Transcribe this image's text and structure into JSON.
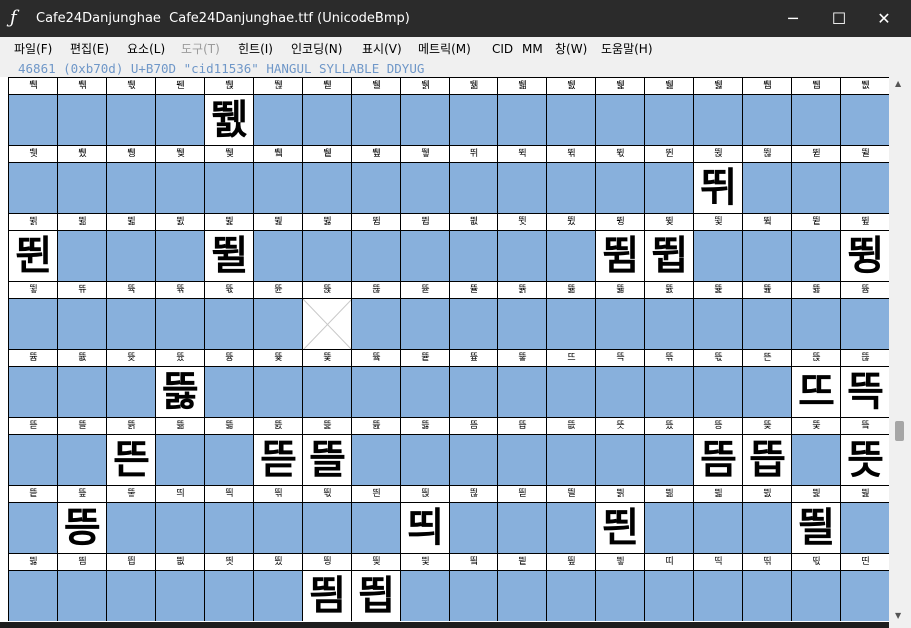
{
  "window": {
    "title": "Cafe24Danjunghae  Cafe24Danjunghae.ttf (UnicodeBmp)",
    "app_icon": "font-icon",
    "min_glyph": "─",
    "max_glyph": "☐",
    "close_glyph": "✕"
  },
  "menu": [
    {
      "label": "파일(F)",
      "enabled": true
    },
    {
      "label": "편집(E)",
      "enabled": true
    },
    {
      "label": "요소(L)",
      "enabled": true
    },
    {
      "label": "도구(T)",
      "enabled": false
    },
    {
      "label": "힌트(I)",
      "enabled": true
    },
    {
      "label": "인코딩(N)",
      "enabled": true
    },
    {
      "label": "표시(V)",
      "enabled": true
    },
    {
      "label": "메트릭(M)",
      "enabled": true
    },
    {
      "label": "CID",
      "enabled": true
    },
    {
      "label": "MM",
      "enabled": true
    },
    {
      "label": "창(W)",
      "enabled": true
    },
    {
      "label": "도움말(H)",
      "enabled": true
    }
  ],
  "glyph_info": "46861 (0xb70d) U+B70D \"cid11536\" HANGUL SYLLABLE DDYUG",
  "grid": {
    "columns": 18,
    "rows": [
      {
        "labels": [
          "뛕",
          "뛖",
          "뛗",
          "뛘",
          "뛙",
          "뛚",
          "뛛",
          "뛜",
          "뛝",
          "뛞",
          "뛟",
          "뛠",
          "뛡",
          "뛢",
          "뛣",
          "뛤",
          "뛥",
          "뛦"
        ],
        "glyphs": [
          "",
          "",
          "",
          "",
          "뛠",
          "",
          "",
          "",
          "",
          "",
          "",
          "",
          "",
          "",
          "",
          "",
          "",
          ""
        ]
      },
      {
        "labels": [
          "뛧",
          "뛨",
          "뛩",
          "뛪",
          "뛫",
          "뛬",
          "뛭",
          "뛮",
          "뛯",
          "뛰",
          "뛱",
          "뛲",
          "뛳",
          "뛴",
          "뛵",
          "뛶",
          "뛷",
          "뛸"
        ],
        "glyphs": [
          "",
          "",
          "",
          "",
          "",
          "",
          "",
          "",
          "",
          "",
          "",
          "",
          "",
          "",
          "뛰",
          "",
          "",
          ""
        ]
      },
      {
        "labels": [
          "뛹",
          "뛺",
          "뛻",
          "뛼",
          "뛽",
          "뛾",
          "뛿",
          "뜀",
          "뜁",
          "뜂",
          "뜃",
          "뜄",
          "뜅",
          "뜆",
          "뜇",
          "뜈",
          "뜉",
          "뜊"
        ],
        "glyphs": [
          "뛴",
          "",
          "",
          "",
          "뛸",
          "",
          "",
          "",
          "",
          "",
          "",
          "",
          "뜀",
          "뜁",
          "",
          "",
          "",
          "뜅"
        ]
      },
      {
        "labels": [
          "뜋",
          "뜌",
          "뜍",
          "뜎",
          "뜏",
          "뜐",
          "뜑",
          "뜒",
          "뜓",
          "뜔",
          "뜕",
          "뜖",
          "뜗",
          "뜘",
          "뜙",
          "뜚",
          "뜛",
          "뜜"
        ],
        "glyphs": [
          "",
          "",
          "",
          "",
          "",
          "",
          "✗",
          "",
          "",
          "",
          "",
          "",
          "",
          "",
          "",
          "",
          "",
          ""
        ]
      },
      {
        "labels": [
          "뜝",
          "뜞",
          "뜟",
          "뜠",
          "뜡",
          "뜢",
          "뜣",
          "뜤",
          "뜥",
          "뜦",
          "뜧",
          "뜨",
          "뜩",
          "뜪",
          "뜫",
          "뜬",
          "뜭",
          "뜮"
        ],
        "glyphs": [
          "",
          "",
          "",
          "뜷",
          "",
          "",
          "",
          "",
          "",
          "",
          "",
          "",
          "",
          "",
          "",
          "",
          "뜨",
          "뜩"
        ]
      },
      {
        "labels": [
          "뜯",
          "뜰",
          "뜱",
          "뜲",
          "뜳",
          "뜴",
          "뜵",
          "뜶",
          "뜷",
          "뜸",
          "뜹",
          "뜺",
          "뜻",
          "뜼",
          "뜽",
          "뜾",
          "뜿",
          "띀"
        ],
        "glyphs": [
          "",
          "",
          "뜬",
          "",
          "",
          "뜯",
          "뜰",
          "",
          "",
          "",
          "",
          "",
          "",
          "",
          "뜸",
          "뜹",
          "",
          "뜻"
        ]
      },
      {
        "labels": [
          "띁",
          "띂",
          "띃",
          "띄",
          "띅",
          "띆",
          "띇",
          "띈",
          "띉",
          "띊",
          "띋",
          "띌",
          "띍",
          "띎",
          "띏",
          "띐",
          "띑",
          "띒"
        ],
        "glyphs": [
          "",
          "뜽",
          "",
          "",
          "",
          "",
          "",
          "",
          "띄",
          "",
          "",
          "",
          "띈",
          "",
          "",
          "",
          "띌",
          ""
        ]
      },
      {
        "labels": [
          "띓",
          "띔",
          "띕",
          "띖",
          "띗",
          "띘",
          "띙",
          "띚",
          "띛",
          "띜",
          "띝",
          "띞",
          "띟",
          "띠",
          "띡",
          "띢",
          "띣",
          "띤"
        ],
        "glyphs": [
          "",
          "",
          "",
          "",
          "",
          "",
          "띔",
          "띕",
          "",
          "",
          "",
          "",
          "",
          "",
          "",
          "",
          "",
          ""
        ]
      }
    ]
  },
  "scrollbar": {
    "up_glyph": "▲",
    "down_glyph": "▼",
    "position": 0.66
  }
}
